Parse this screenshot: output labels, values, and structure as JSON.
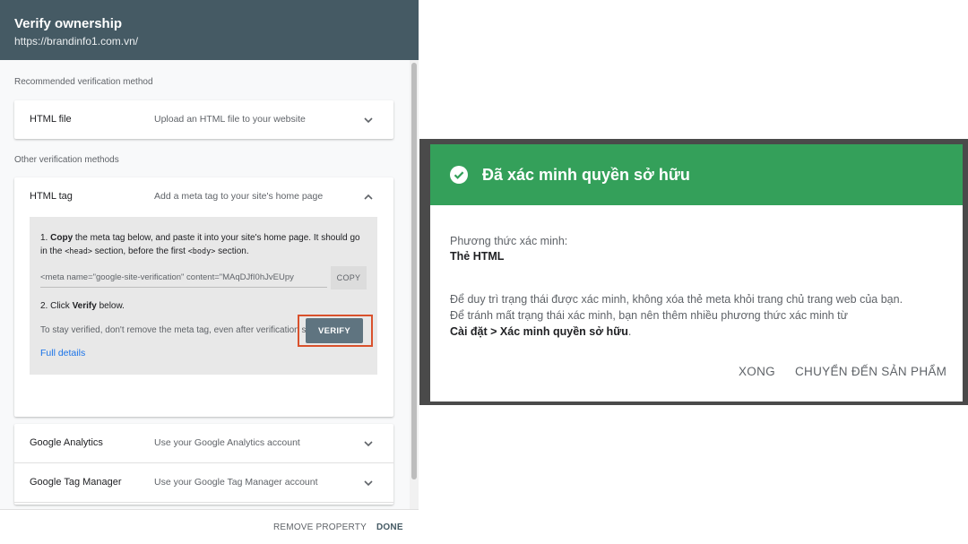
{
  "verify_panel": {
    "title": "Verify ownership",
    "url": "https://brandinfo1.com.vn/",
    "recommended_label": "Recommended verification method",
    "recommended": {
      "name": "HTML file",
      "desc": "Upload an HTML file to your website",
      "icon": "chevron-down-icon"
    },
    "other_label": "Other verification methods",
    "html_tag": {
      "name": "HTML tag",
      "desc": "Add a meta tag to your site's home page",
      "icon": "chevron-up-icon",
      "step1_prefix": "1. ",
      "step1_bold": "Copy",
      "step1_text_a": " the meta tag below, and paste it into your site's home page. It should go in the ",
      "step1_code_head": "<head>",
      "step1_text_b": " section, before the first ",
      "step1_code_body": "<body>",
      "step1_text_c": " section.",
      "meta_value": "<meta name=\"google-site-verification\" content=\"MAqDJfI0hJvEUpy",
      "copy_label": "COPY",
      "step2_prefix": "2. Click ",
      "step2_bold": "Verify",
      "step2_suffix": " below.",
      "stay_text": "To stay verified, don't remove the meta tag, even after verification succeeds.",
      "full_details": "Full details",
      "verify_label": "VERIFY"
    },
    "methods": [
      {
        "name": "Google Analytics",
        "desc": "Use your Google Analytics account"
      },
      {
        "name": "Google Tag Manager",
        "desc": "Use your Google Tag Manager account"
      }
    ],
    "footer": {
      "remove_label": "REMOVE PROPERTY",
      "done_label": "DONE"
    },
    "colors": {
      "header": "#455a64",
      "verify_button": "#5f7480",
      "highlight": "#d9512c",
      "link": "#1a73e8"
    }
  },
  "success_dialog": {
    "title": "Đã xác minh quyền sở hữu",
    "icon": "check-circle-icon",
    "method_label": "Phương thức xác minh:",
    "method_value": "Thẻ HTML",
    "line1": "Để duy trì trạng thái được xác minh, không xóa thẻ meta khỏi trang chủ trang web của bạn.",
    "line2": "Để tránh mất trạng thái xác minh, bạn nên thêm nhiều phương thức xác minh từ",
    "settings_path": "Cài đặt > Xác minh quyền sở hữu",
    "settings_suffix": ".",
    "btn_done": "XONG",
    "btn_goto": "CHUYỂN ĐẾN SẢN PHẨM",
    "colors": {
      "header": "#34a05a"
    }
  }
}
